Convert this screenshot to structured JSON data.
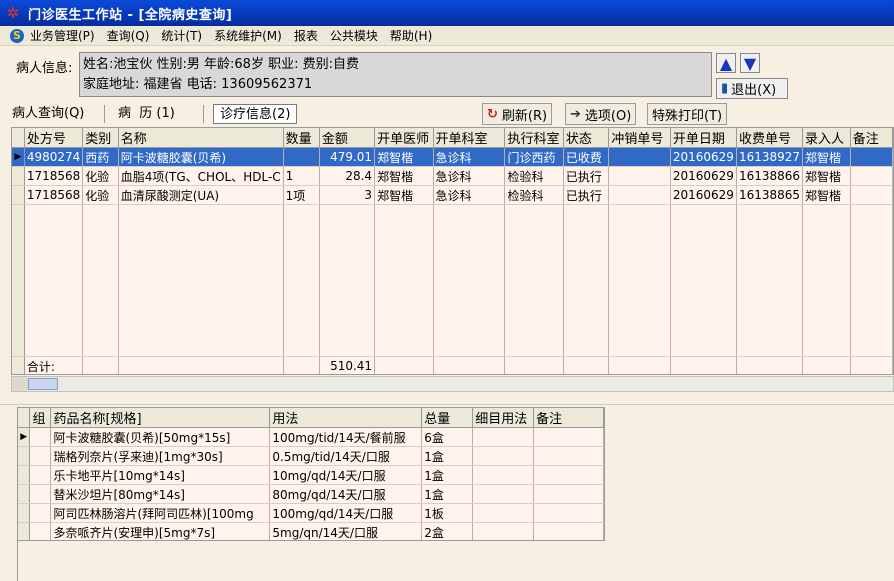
{
  "window": {
    "title": "门诊医生工作站 - [全院病史查询]"
  },
  "menu": [
    "业务管理(P)",
    "查询(Q)",
    "统计(T)",
    "系统维护(M)",
    "报表",
    "公共模块",
    "帮助(H)"
  ],
  "patient": {
    "label": "病人信息:",
    "line1": "姓名:池宝伙 性别:男 年龄:68岁  职业: 费别:自费",
    "line2": "家庭地址: 福建省 电话: 13609562371"
  },
  "buttons": {
    "exit": "退出(X)",
    "refresh": "刷新(R)",
    "options": "选项(O)",
    "print": "特殊打印(T)"
  },
  "tabs": [
    "病人查询(Q)",
    "病  历 (1)",
    "诊疗信息(2)"
  ],
  "orders": {
    "columns": [
      "处方号",
      "类别",
      "名称",
      "数量",
      "金额",
      "开单医师",
      "开单科室",
      "执行科室",
      "状态",
      "冲销单号",
      "开单日期",
      "收费单号",
      "录入人",
      "备注"
    ],
    "rows": [
      [
        "4980274",
        "西药",
        "阿卡波糖胶囊(贝希)",
        "",
        "479.01",
        "郑智楷",
        "急诊科",
        "门诊西药",
        "已收费",
        "",
        "20160629",
        "16138927",
        "郑智楷",
        ""
      ],
      [
        "1718568",
        "化验",
        "血脂4项(TG、CHOL、HDL-C",
        "1",
        "28.4",
        "郑智楷",
        "急诊科",
        "检验科",
        "已执行",
        "",
        "20160629",
        "16138866",
        "郑智楷",
        ""
      ],
      [
        "1718568",
        "化验",
        "血清尿酸测定(UA)",
        "1项",
        "3",
        "郑智楷",
        "急诊科",
        "检验科",
        "已执行",
        "",
        "20160629",
        "16138865",
        "郑智楷",
        ""
      ]
    ],
    "total_label": "合计:",
    "total_value": "510.41"
  },
  "drugs": {
    "columns": [
      "组",
      "药品名称[规格]",
      "用法",
      "总量",
      "细目用法",
      "备注"
    ],
    "rows": [
      [
        "",
        "阿卡波糖胶囊(贝希)[50mg*15s]",
        "100mg/tid/14天/餐前服",
        "6盒",
        "",
        ""
      ],
      [
        "",
        "瑞格列奈片(孚来迪)[1mg*30s]",
        "0.5mg/tid/14天/口服",
        "1盒",
        "",
        ""
      ],
      [
        "",
        "乐卡地平片[10mg*14s]",
        "10mg/qd/14天/口服",
        "1盒",
        "",
        ""
      ],
      [
        "",
        "替米沙坦片[80mg*14s]",
        "80mg/qd/14天/口服",
        "1盒",
        "",
        ""
      ],
      [
        "",
        "阿司匹林肠溶片(拜阿司匹林)[100mg",
        "100mg/qd/14天/口服",
        "1板",
        "",
        ""
      ],
      [
        "",
        "多奈哌齐片(安理申)[5mg*7s]",
        "5mg/qn/14天/口服",
        "2盒",
        "",
        ""
      ]
    ]
  }
}
